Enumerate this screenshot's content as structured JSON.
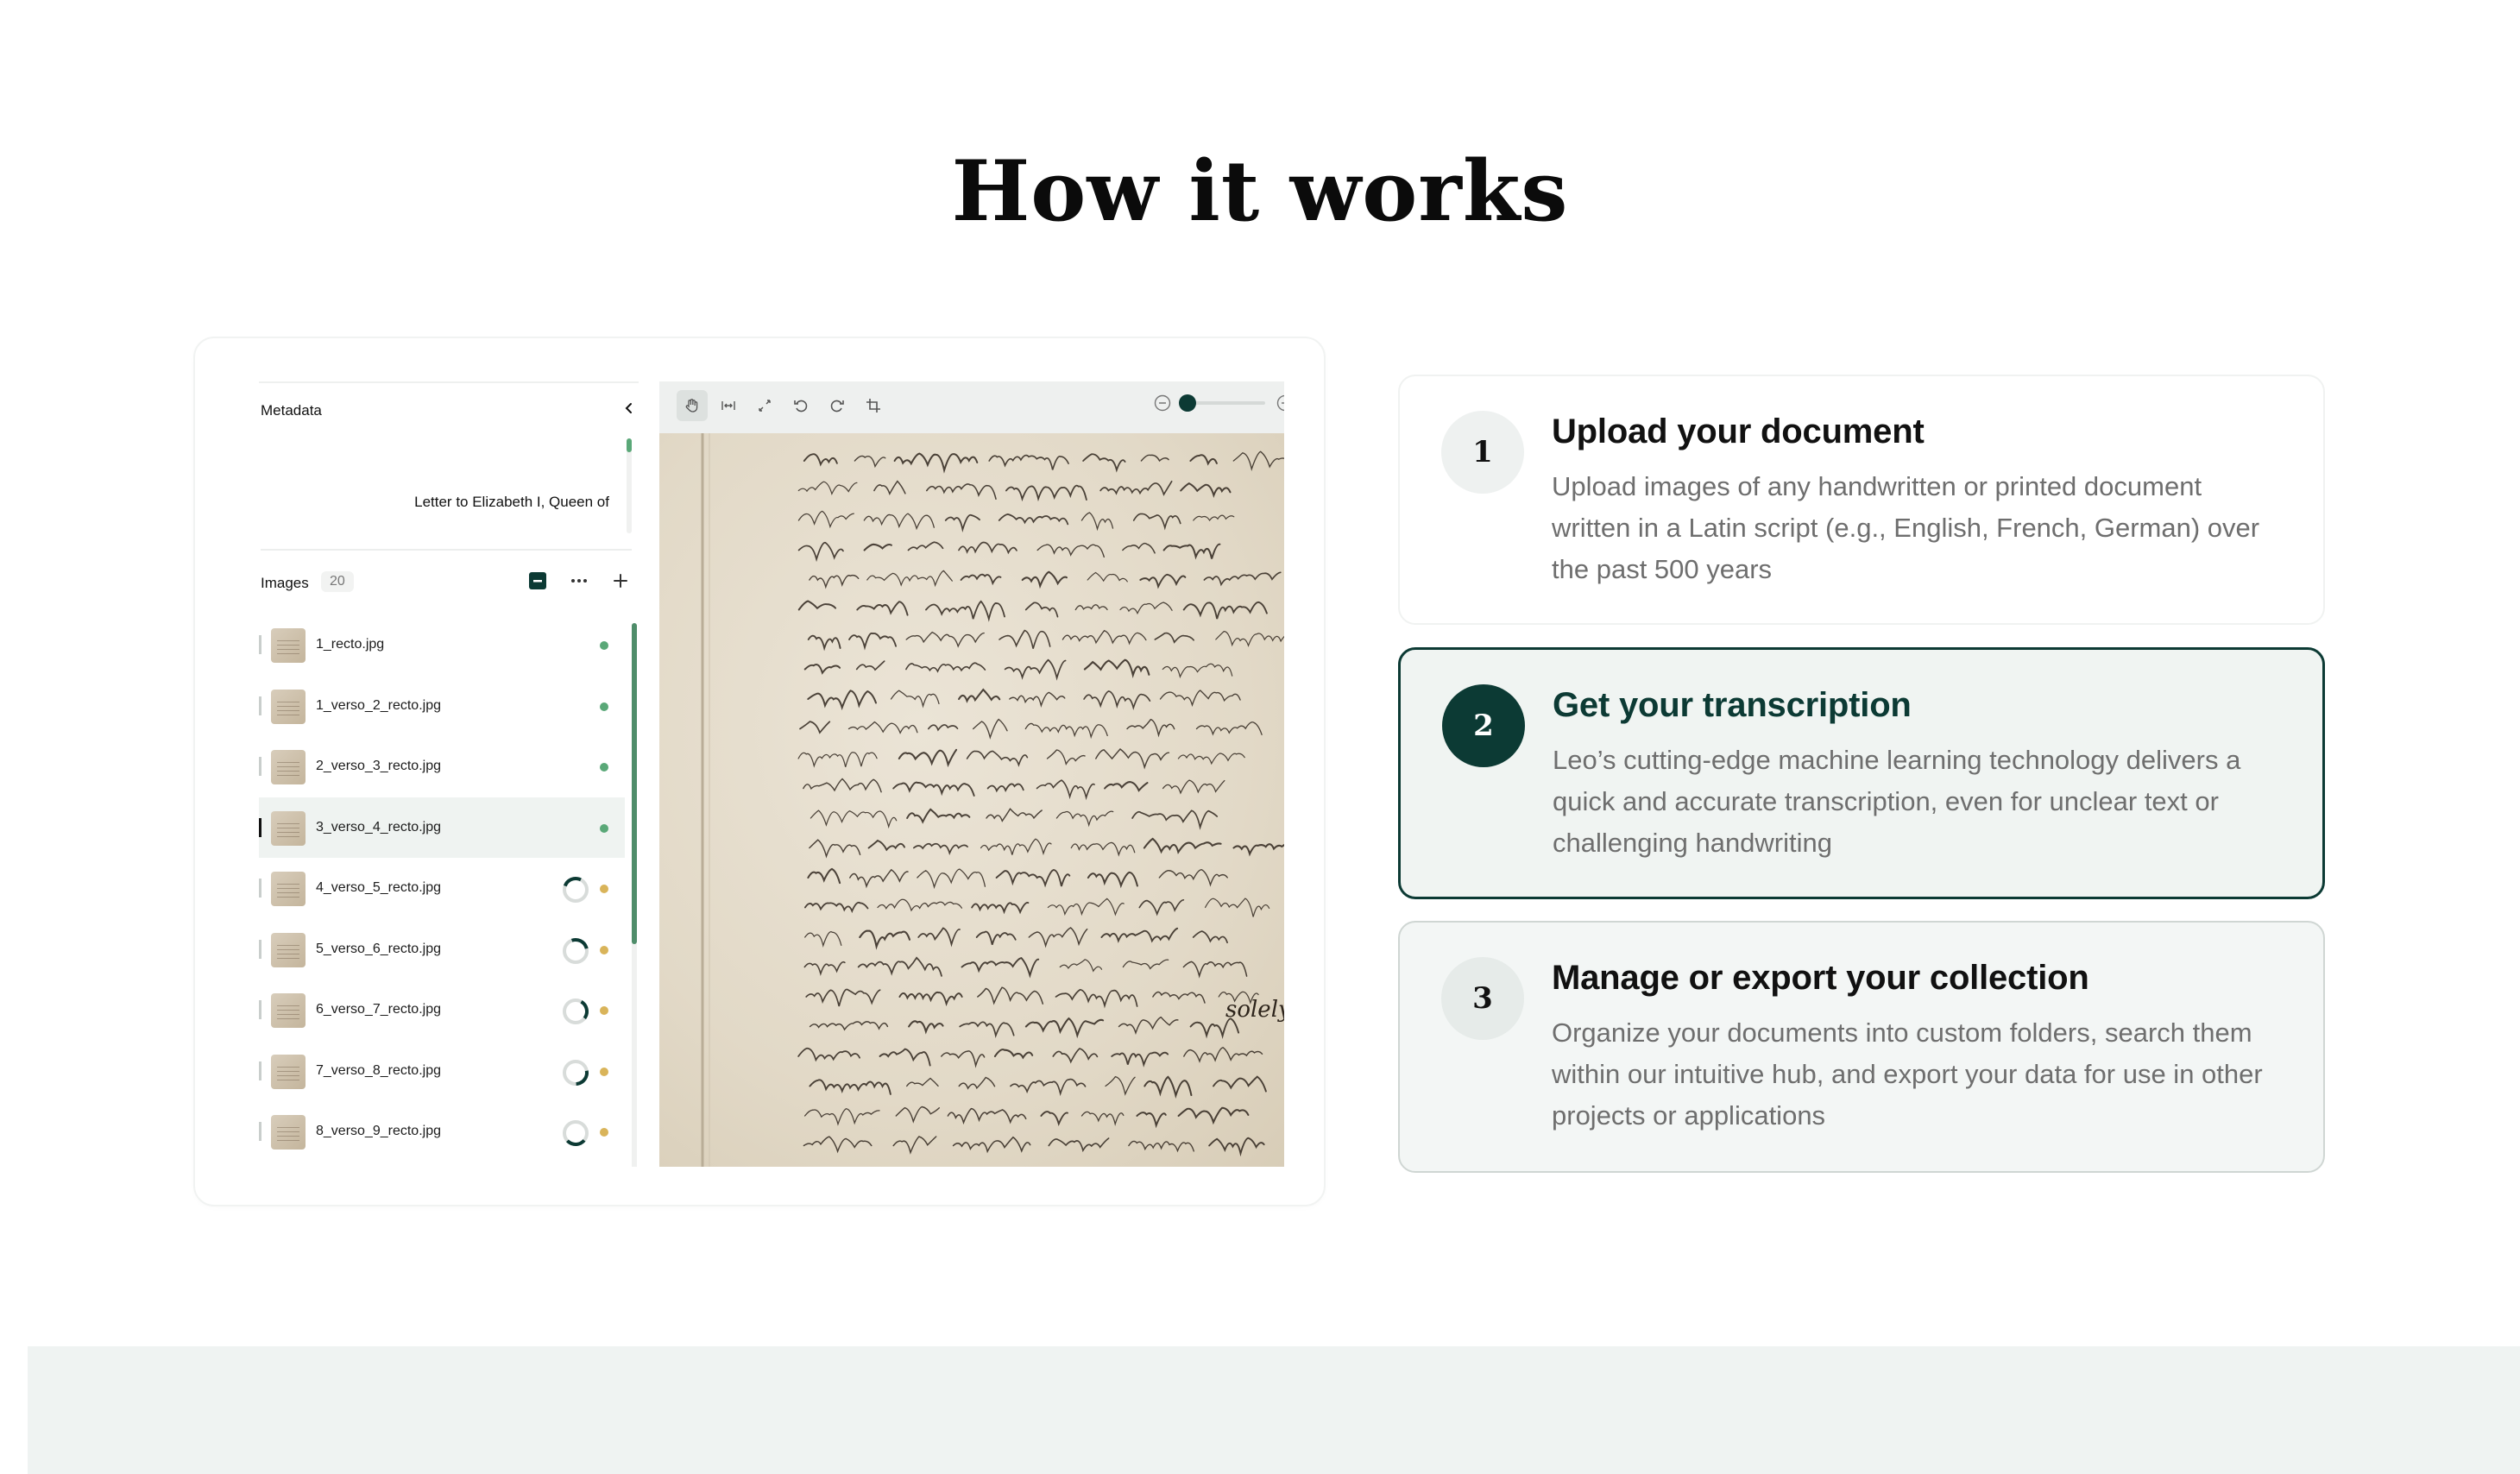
{
  "page": {
    "title": "How it works"
  },
  "app": {
    "metadata": {
      "label": "Metadata",
      "value": "Letter to Elizabeth I, Queen of"
    },
    "images": {
      "label": "Images",
      "count": "20",
      "files": [
        {
          "name": "1_recto.jpg",
          "status": "done"
        },
        {
          "name": "1_verso_2_recto.jpg",
          "status": "done"
        },
        {
          "name": "2_verso_3_recto.jpg",
          "status": "done"
        },
        {
          "name": "3_verso_4_recto.jpg",
          "status": "done",
          "selected": true
        },
        {
          "name": "4_verso_5_recto.jpg",
          "status": "processing"
        },
        {
          "name": "5_verso_6_recto.jpg",
          "status": "processing"
        },
        {
          "name": "6_verso_7_recto.jpg",
          "status": "processing"
        },
        {
          "name": "7_verso_8_recto.jpg",
          "status": "processing"
        },
        {
          "name": "8_verso_9_recto.jpg",
          "status": "processing"
        }
      ]
    },
    "viewer": {
      "tools": [
        "hand-icon",
        "fit-width-icon",
        "expand-icon",
        "rotate-left-icon",
        "rotate-right-icon",
        "crop-icon"
      ],
      "zoom_level": 0.1,
      "manuscript_annotation": "solely"
    }
  },
  "steps": [
    {
      "number": "1",
      "title": "Upload your document",
      "description": "Upload images of any handwritten or printed document written in a Latin script (e.g., English, French, German) over the past 500 years"
    },
    {
      "number": "2",
      "title": "Get your transcription",
      "description": "Leo’s cutting-edge machine learning technology delivers a quick and accurate transcription, even for unclear text or challenging handwriting"
    },
    {
      "number": "3",
      "title": "Manage or export your collection",
      "description": "Organize your documents into custom folders, search them within our intuitive hub, and export your data for use in other projects or applications"
    }
  ],
  "colors": {
    "brand_dark": "#0c3a34",
    "status_done": "#5aa878",
    "status_processing": "#d9b45a",
    "highlight_bg": "#f0f4f2"
  }
}
